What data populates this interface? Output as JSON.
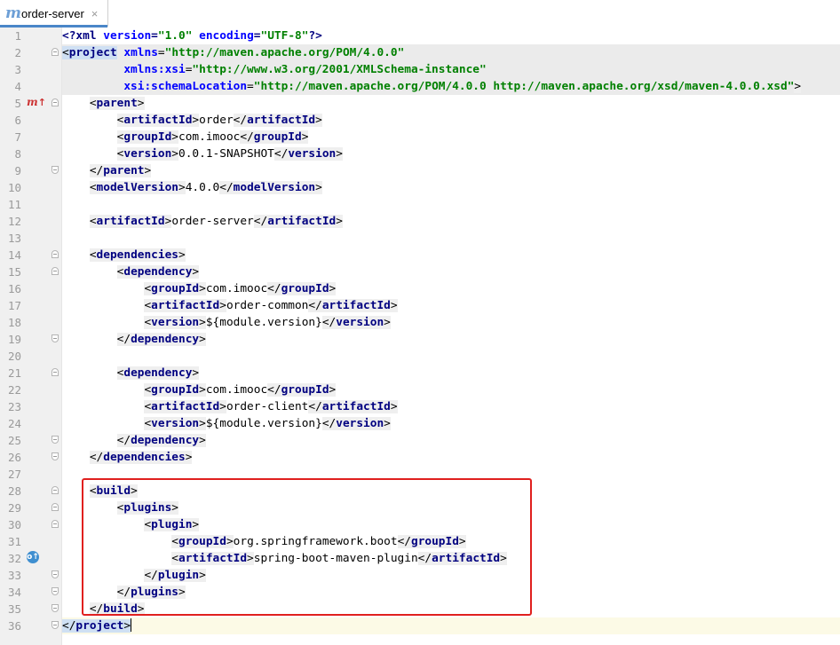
{
  "tab": {
    "label": "order-server",
    "icon": "maven-icon",
    "close": "×"
  },
  "colors": {
    "tag": "#000080",
    "attr": "#0000ff",
    "value": "#008000",
    "highlight_box": "#e0201e"
  },
  "lines": [
    {
      "n": "1",
      "tokens": [
        [
          "pi",
          "<?xml "
        ],
        [
          "attr",
          "version"
        ],
        [
          "pi",
          "="
        ],
        [
          "val",
          "\"1.0\""
        ],
        [
          "pi",
          " "
        ],
        [
          "attr",
          "encoding"
        ],
        [
          "pi",
          "="
        ],
        [
          "val",
          "\"UTF-8\""
        ],
        [
          "pi",
          "?>"
        ]
      ]
    },
    {
      "n": "2",
      "fold": "start",
      "hl": true,
      "tokens": [
        [
          "tagbg-hl",
          "<project"
        ],
        [
          "txt",
          " "
        ],
        [
          "attr",
          "xmlns"
        ],
        [
          "txt",
          "="
        ],
        [
          "val",
          "\"http://maven.apache.org/POM/4.0.0\""
        ]
      ]
    },
    {
      "n": "3",
      "hl": true,
      "tokens": [
        [
          "txt",
          "         "
        ],
        [
          "attr",
          "xmlns:xsi"
        ],
        [
          "txt",
          "="
        ],
        [
          "val",
          "\"http://www.w3.org/2001/XMLSchema-instance\""
        ]
      ]
    },
    {
      "n": "4",
      "hl": true,
      "tokens": [
        [
          "txt",
          "         "
        ],
        [
          "attr",
          "xsi:schemaLocation"
        ],
        [
          "txt",
          "="
        ],
        [
          "val",
          "\"http://maven.apache.org/POM/4.0.0 http://maven.apache.org/xsd/maven-4.0.0.xsd\""
        ],
        [
          "tagbg",
          ">"
        ]
      ]
    },
    {
      "n": "5",
      "fold": "start",
      "gicon": "maven",
      "tokens": [
        [
          "txt",
          "    "
        ],
        [
          "tagbg",
          "<parent>"
        ]
      ]
    },
    {
      "n": "6",
      "tokens": [
        [
          "txt",
          "        "
        ],
        [
          "tagbg",
          "<artifactId>"
        ],
        [
          "txt",
          "order"
        ],
        [
          "tagbg",
          "</artifactId>"
        ]
      ]
    },
    {
      "n": "7",
      "tokens": [
        [
          "txt",
          "        "
        ],
        [
          "tagbg",
          "<groupId>"
        ],
        [
          "txt",
          "com.imooc"
        ],
        [
          "tagbg",
          "</groupId>"
        ]
      ]
    },
    {
      "n": "8",
      "tokens": [
        [
          "txt",
          "        "
        ],
        [
          "tagbg",
          "<version>"
        ],
        [
          "txt",
          "0.0.1-SNAPSHOT"
        ],
        [
          "tagbg",
          "</version>"
        ]
      ]
    },
    {
      "n": "9",
      "fold": "end",
      "tokens": [
        [
          "txt",
          "    "
        ],
        [
          "tagbg",
          "</parent>"
        ]
      ]
    },
    {
      "n": "10",
      "tokens": [
        [
          "txt",
          "    "
        ],
        [
          "tagbg",
          "<modelVersion>"
        ],
        [
          "txt",
          "4.0.0"
        ],
        [
          "tagbg",
          "</modelVersion>"
        ]
      ]
    },
    {
      "n": "11",
      "tokens": []
    },
    {
      "n": "12",
      "tokens": [
        [
          "txt",
          "    "
        ],
        [
          "tagbg",
          "<artifactId>"
        ],
        [
          "txt",
          "order-server"
        ],
        [
          "tagbg",
          "</artifactId>"
        ]
      ]
    },
    {
      "n": "13",
      "tokens": []
    },
    {
      "n": "14",
      "fold": "start",
      "tokens": [
        [
          "txt",
          "    "
        ],
        [
          "tagbg",
          "<dependencies>"
        ]
      ]
    },
    {
      "n": "15",
      "fold": "start",
      "tokens": [
        [
          "txt",
          "        "
        ],
        [
          "tagbg",
          "<dependency>"
        ]
      ]
    },
    {
      "n": "16",
      "tokens": [
        [
          "txt",
          "            "
        ],
        [
          "tagbg",
          "<groupId>"
        ],
        [
          "txt",
          "com.imooc"
        ],
        [
          "tagbg",
          "</groupId>"
        ]
      ]
    },
    {
      "n": "17",
      "tokens": [
        [
          "txt",
          "            "
        ],
        [
          "tagbg",
          "<artifactId>"
        ],
        [
          "txt",
          "order-common"
        ],
        [
          "tagbg",
          "</artifactId>"
        ]
      ]
    },
    {
      "n": "18",
      "tokens": [
        [
          "txt",
          "            "
        ],
        [
          "tagbg",
          "<version>"
        ],
        [
          "txt",
          "${module.version}"
        ],
        [
          "tagbg",
          "</version>"
        ]
      ]
    },
    {
      "n": "19",
      "fold": "end",
      "tokens": [
        [
          "txt",
          "        "
        ],
        [
          "tagbg",
          "</dependency>"
        ]
      ]
    },
    {
      "n": "20",
      "tokens": []
    },
    {
      "n": "21",
      "fold": "start",
      "tokens": [
        [
          "txt",
          "        "
        ],
        [
          "tagbg",
          "<dependency>"
        ]
      ]
    },
    {
      "n": "22",
      "tokens": [
        [
          "txt",
          "            "
        ],
        [
          "tagbg",
          "<groupId>"
        ],
        [
          "txt",
          "com.imooc"
        ],
        [
          "tagbg",
          "</groupId>"
        ]
      ]
    },
    {
      "n": "23",
      "tokens": [
        [
          "txt",
          "            "
        ],
        [
          "tagbg",
          "<artifactId>"
        ],
        [
          "txt",
          "order-client"
        ],
        [
          "tagbg",
          "</artifactId>"
        ]
      ]
    },
    {
      "n": "24",
      "tokens": [
        [
          "txt",
          "            "
        ],
        [
          "tagbg",
          "<version>"
        ],
        [
          "txt",
          "${module.version}"
        ],
        [
          "tagbg",
          "</version>"
        ]
      ]
    },
    {
      "n": "25",
      "fold": "end",
      "tokens": [
        [
          "txt",
          "        "
        ],
        [
          "tagbg",
          "</dependency>"
        ]
      ]
    },
    {
      "n": "26",
      "fold": "end",
      "tokens": [
        [
          "txt",
          "    "
        ],
        [
          "tagbg",
          "</dependencies>"
        ]
      ]
    },
    {
      "n": "27",
      "tokens": []
    },
    {
      "n": "28",
      "fold": "start",
      "tokens": [
        [
          "txt",
          "    "
        ],
        [
          "tagbg",
          "<build>"
        ]
      ]
    },
    {
      "n": "29",
      "fold": "start",
      "tokens": [
        [
          "txt",
          "        "
        ],
        [
          "tagbg",
          "<plugins>"
        ]
      ]
    },
    {
      "n": "30",
      "fold": "start",
      "tokens": [
        [
          "txt",
          "            "
        ],
        [
          "tagbg",
          "<plugin>"
        ]
      ]
    },
    {
      "n": "31",
      "tokens": [
        [
          "txt",
          "                "
        ],
        [
          "tagbg",
          "<groupId>"
        ],
        [
          "txt",
          "org.springframework.boot"
        ],
        [
          "tagbg",
          "</groupId>"
        ]
      ]
    },
    {
      "n": "32",
      "gicon": "override",
      "tokens": [
        [
          "txt",
          "                "
        ],
        [
          "tagbg",
          "<artifactId>"
        ],
        [
          "txt",
          "spring-boot-maven-plugin"
        ],
        [
          "tagbg",
          "</artifactId>"
        ]
      ]
    },
    {
      "n": "33",
      "fold": "end",
      "tokens": [
        [
          "txt",
          "            "
        ],
        [
          "tagbg",
          "</plugin>"
        ]
      ]
    },
    {
      "n": "34",
      "fold": "end",
      "tokens": [
        [
          "txt",
          "        "
        ],
        [
          "tagbg",
          "</plugins>"
        ]
      ]
    },
    {
      "n": "35",
      "fold": "end",
      "tokens": [
        [
          "txt",
          "    "
        ],
        [
          "tagbg",
          "</build>"
        ]
      ]
    },
    {
      "n": "36",
      "fold": "end",
      "caret": true,
      "tokens": [
        [
          "tagbg-hl",
          "</project>"
        ]
      ]
    }
  ]
}
